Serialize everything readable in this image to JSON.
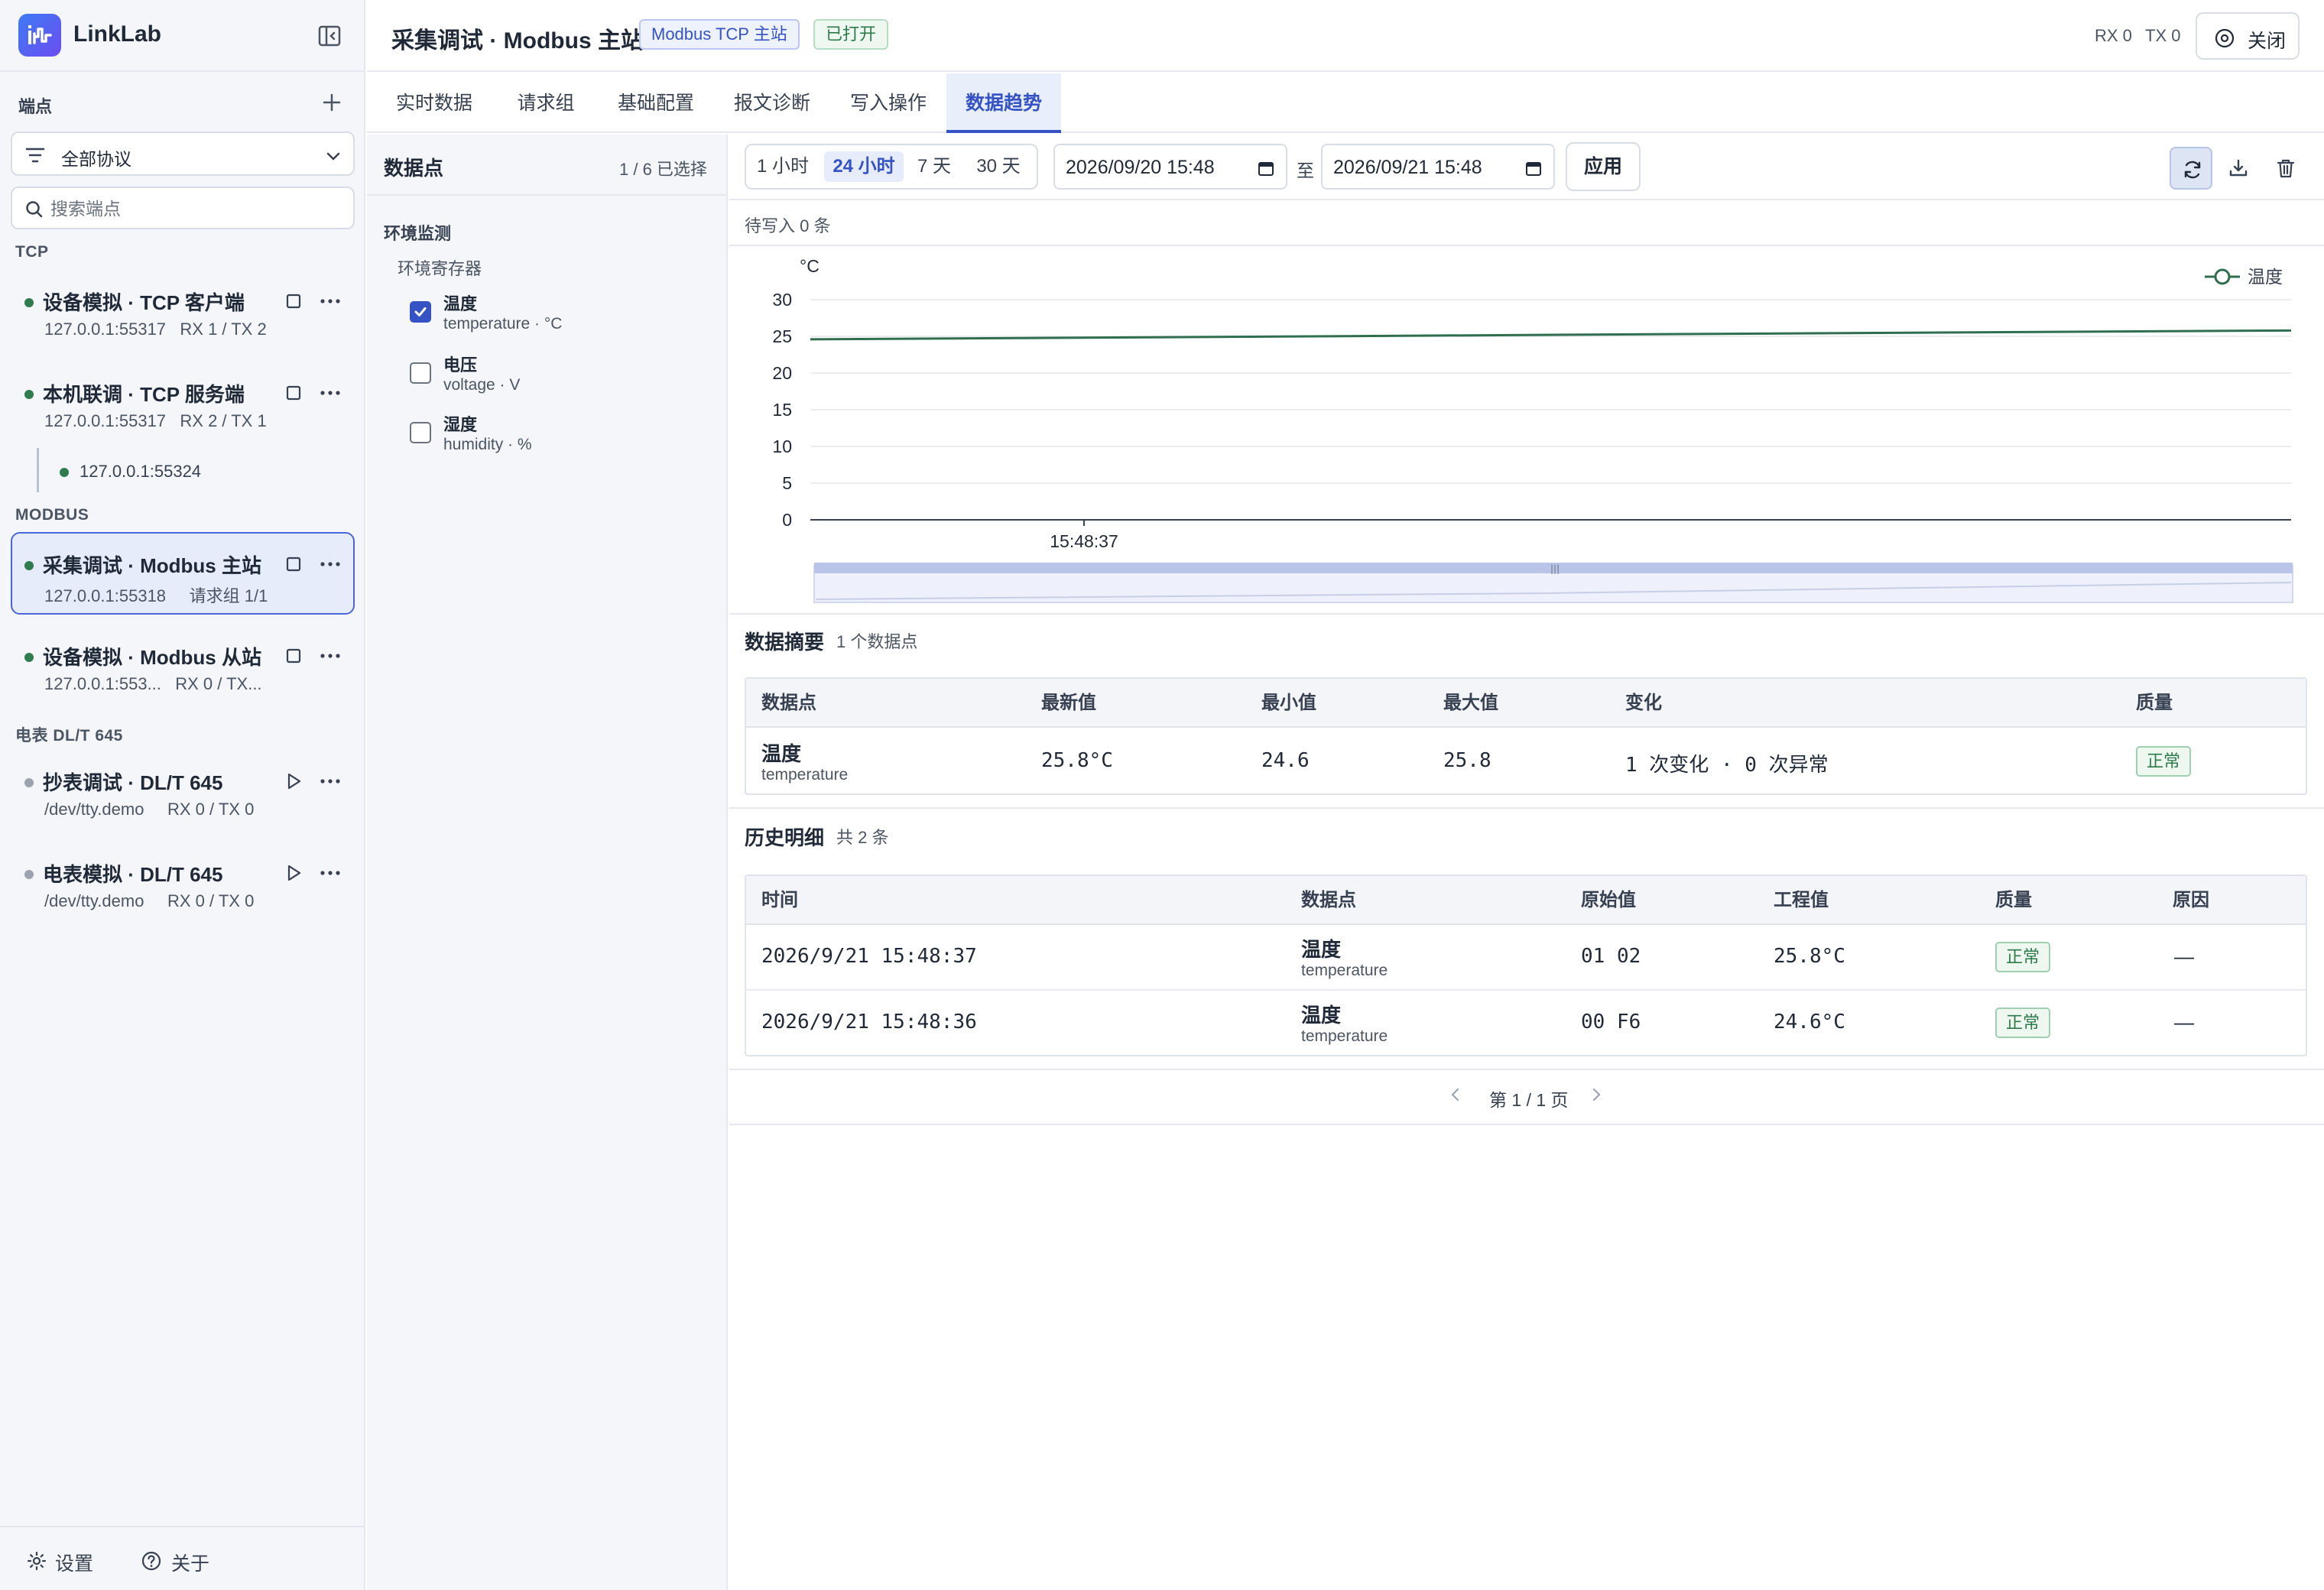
{
  "app": {
    "name": "LinkLab"
  },
  "sidebar": {
    "title": "端点",
    "filter_label": "全部协议",
    "search_placeholder": "搜索端点",
    "groups": {
      "tcp": "TCP",
      "modbus": "MODBUS",
      "dlt": "电表 DL/T 645"
    },
    "endpoints": [
      {
        "name": "设备模拟 · TCP 客户端",
        "address": "127.0.0.1:55317",
        "stats": "RX 1 / TX 2",
        "status_color": "#2f7d4f"
      },
      {
        "name": "本机联调 · TCP 服务端",
        "address": "127.0.0.1:55317",
        "stats": "RX 2 / TX 1",
        "status_color": "#2f7d4f"
      },
      {
        "name": "采集调试 · Modbus 主站",
        "address": "127.0.0.1:55318",
        "stats": "请求组 1/1",
        "status_color": "#2f7d4f"
      },
      {
        "name": "设备模拟 · Modbus 从站",
        "address": "127.0.0.1:553...",
        "stats": "RX 0 / TX...",
        "status_color": "#2f7d4f"
      },
      {
        "name": "抄表调试 · DL/T 645",
        "address": "/dev/tty.demo",
        "stats": "RX 0 / TX 0",
        "status_color": "#9ca3af"
      },
      {
        "name": "电表模拟 · DL/T 645",
        "address": "/dev/tty.demo",
        "stats": "RX 0 / TX 0",
        "status_color": "#9ca3af"
      }
    ],
    "child_connection": "127.0.0.1:55324",
    "footer": {
      "settings": "设置",
      "about": "关于"
    }
  },
  "header": {
    "title": "采集调试 · Modbus 主站",
    "protocol_badge": "Modbus TCP 主站",
    "status_badge": "已打开",
    "rx": "RX 0",
    "tx": "TX 0",
    "close_label": "关闭"
  },
  "tabs": [
    "实时数据",
    "请求组",
    "基础配置",
    "报文诊断",
    "写入操作",
    "数据趋势"
  ],
  "active_tab": "数据趋势",
  "datapoints": {
    "title": "数据点",
    "count": "1 / 6 已选择",
    "group": "环境监测",
    "subgroup": "环境寄存器",
    "items": [
      {
        "name": "温度",
        "meta": "temperature · °C",
        "checked": true
      },
      {
        "name": "电压",
        "meta": "voltage · V",
        "checked": false
      },
      {
        "name": "湿度",
        "meta": "humidity · %",
        "checked": false
      }
    ]
  },
  "toolbar": {
    "ranges": [
      "1 小时",
      "24 小时",
      "7 天",
      "30 天"
    ],
    "active_range": "24 小时",
    "from": "2026/09/20 15:48",
    "to_label": "至",
    "to": "2026/09/21 15:48",
    "apply": "应用"
  },
  "pending": "待写入 0 条",
  "chart_data": {
    "type": "line",
    "ylabel": "°C",
    "ylim": [
      0,
      30
    ],
    "yticks": [
      0,
      5,
      10,
      15,
      20,
      25,
      30
    ],
    "xticks": [
      "15:48:37"
    ],
    "legend": "top-right",
    "series": [
      {
        "name": "温度",
        "color": "#2f6f4f",
        "values": [
          24.6,
          25.8
        ]
      }
    ]
  },
  "summary": {
    "title": "数据摘要",
    "count": "1 个数据点",
    "headers": [
      "数据点",
      "最新值",
      "最小值",
      "最大值",
      "变化",
      "质量"
    ],
    "rows": [
      {
        "name": "温度",
        "sub": "temperature",
        "latest": "25.8°C",
        "min": "24.6",
        "max": "25.8",
        "change": "1 次变化 · 0 次异常",
        "quality": "正常"
      }
    ]
  },
  "history": {
    "title": "历史明细",
    "count": "共 2 条",
    "headers": [
      "时间",
      "数据点",
      "原始值",
      "工程值",
      "质量",
      "原因"
    ],
    "rows": [
      {
        "time": "2026/9/21 15:48:37",
        "name": "温度",
        "sub": "temperature",
        "raw": "01 02",
        "eng": "25.8°C",
        "quality": "正常",
        "reason": "—"
      },
      {
        "time": "2026/9/21 15:48:36",
        "name": "温度",
        "sub": "temperature",
        "raw": "00 F6",
        "eng": "24.6°C",
        "quality": "正常",
        "reason": "—"
      }
    ]
  },
  "pager": "第 1 / 1 页"
}
